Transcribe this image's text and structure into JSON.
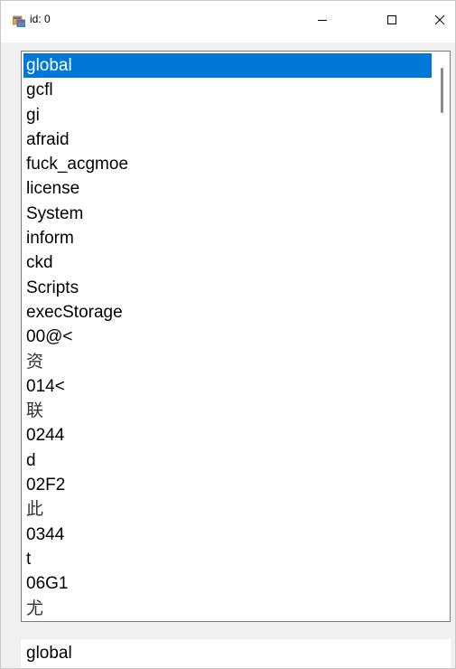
{
  "window": {
    "title": "id: 0",
    "controls": {
      "minimize": "minimize-icon",
      "maximize": "maximize-icon",
      "close": "close-icon"
    }
  },
  "listbox": {
    "selected_index": 0,
    "items": [
      {
        "label": "global"
      },
      {
        "label": "gcfl"
      },
      {
        "label": "gi"
      },
      {
        "label": "afraid"
      },
      {
        "label": "fuck_acgmoe"
      },
      {
        "label": "license"
      },
      {
        "label": "System"
      },
      {
        "label": "inform"
      },
      {
        "label": "ckd"
      },
      {
        "label": "Scripts"
      },
      {
        "label": "execStorage"
      },
      {
        "label": "00@<"
      },
      {
        "label": "资"
      },
      {
        "label": "014<"
      },
      {
        "label": "联"
      },
      {
        "label": "0244"
      },
      {
        "label": "d"
      },
      {
        "label": "02F2"
      },
      {
        "label": "此"
      },
      {
        "label": "0344"
      },
      {
        "label": "t"
      },
      {
        "label": "06G1"
      },
      {
        "label": "尤"
      }
    ]
  },
  "textbox": {
    "value": "global"
  },
  "colors": {
    "selection": "#0078d7",
    "selection_text": "#ffffff"
  }
}
